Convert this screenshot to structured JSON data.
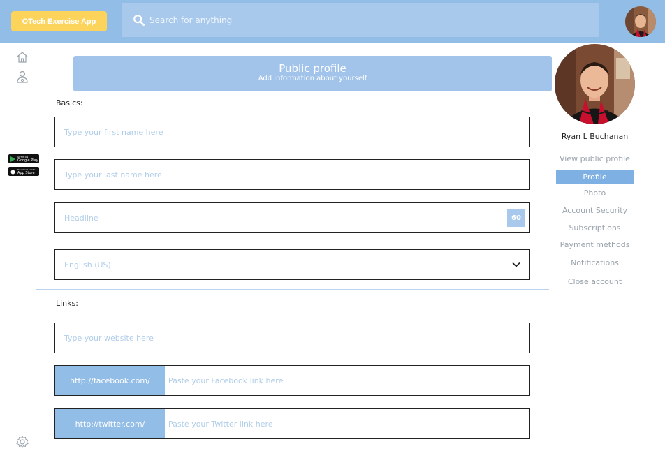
{
  "header": {
    "app_name": "OTech Exercise App",
    "search_placeholder": "Search for anything"
  },
  "sidebar": {
    "icons": [
      "home-icon",
      "user-icon",
      "settings-icon"
    ],
    "badges": [
      {
        "name": "google-play-badge",
        "small": "GET IT ON",
        "label": "Google Play"
      },
      {
        "name": "app-store-badge",
        "small": "Download on the",
        "label": "App Store"
      }
    ]
  },
  "banner": {
    "title": "Public profile",
    "subtitle": "Add information about yourself"
  },
  "basics": {
    "label": "Basics:",
    "first_name_placeholder": "Type your first name here",
    "last_name_placeholder": "Type your last name here",
    "headline_placeholder": "Headline",
    "headline_counter": "60",
    "language_value": "English (US)"
  },
  "links": {
    "label": "Links:",
    "website_placeholder": "Type your website here",
    "facebook_prefix": "http://facebook.com/",
    "facebook_placeholder": "Paste your Facebook link here",
    "twitter_prefix": "http://twitter.com/",
    "twitter_placeholder": "Paste your Twitter link here"
  },
  "profile": {
    "name": "Ryan L Buchanan",
    "nav": [
      {
        "label": "View public profile",
        "active": false
      },
      {
        "label": "Profile",
        "active": true
      },
      {
        "label": "Photo",
        "active": false
      },
      {
        "label": "Account Security",
        "active": false
      },
      {
        "label": "Subscriptions",
        "active": false
      },
      {
        "label": "Payment methods",
        "active": false
      },
      {
        "label": "Notifications",
        "active": false
      },
      {
        "label": "Close account",
        "active": false
      }
    ]
  },
  "colors": {
    "topbar": "#92bde6",
    "accent": "#fcd45c",
    "active_nav": "#7fb0e3"
  }
}
